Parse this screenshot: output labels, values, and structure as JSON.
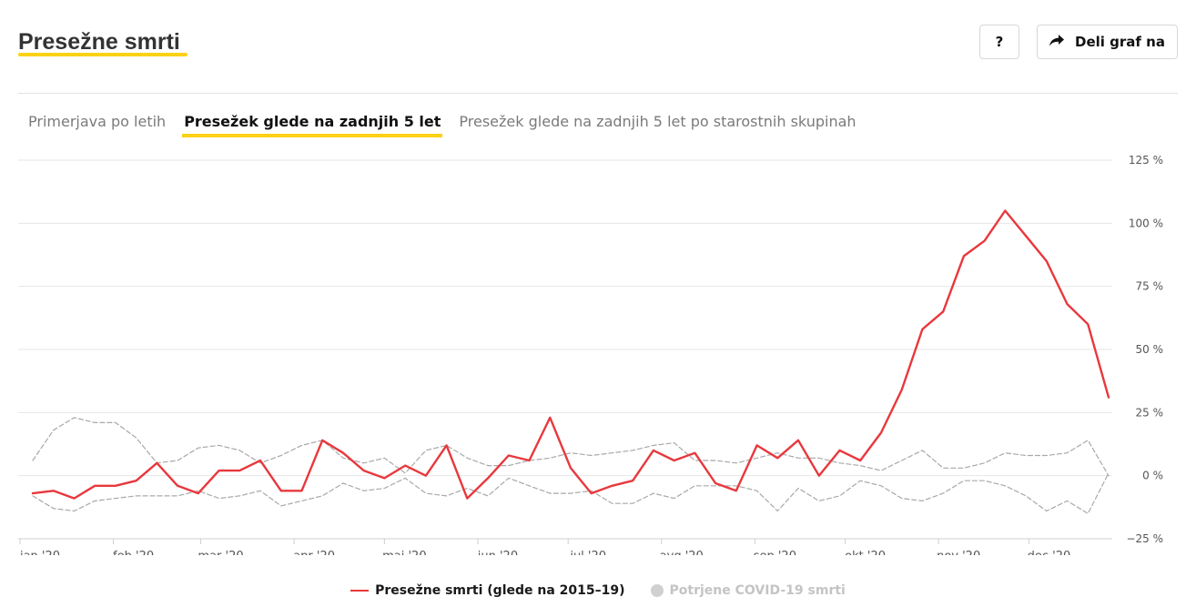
{
  "header": {
    "title": "Presežne smrti",
    "help_label": "?",
    "share_label": "Deli graf na",
    "share_icon": "share-arrow-icon",
    "accent_color": "#fcd116"
  },
  "tabs": [
    {
      "label": "Primerjava po letih",
      "active": false
    },
    {
      "label": "Presežek glede na zadnjih 5 let",
      "active": true
    },
    {
      "label": "Presežek glede na zadnjih 5 let po starostnih skupinah",
      "active": false
    }
  ],
  "chart_data": {
    "type": "line",
    "x": [
      "2020-01-01",
      "2020-01-08",
      "2020-01-15",
      "2020-01-22",
      "2020-01-29",
      "2020-02-05",
      "2020-02-12",
      "2020-02-19",
      "2020-02-26",
      "2020-03-04",
      "2020-03-11",
      "2020-03-18",
      "2020-03-25",
      "2020-04-01",
      "2020-04-08",
      "2020-04-15",
      "2020-04-22",
      "2020-04-29",
      "2020-05-06",
      "2020-05-13",
      "2020-05-20",
      "2020-05-27",
      "2020-06-03",
      "2020-06-10",
      "2020-06-17",
      "2020-06-24",
      "2020-07-01",
      "2020-07-08",
      "2020-07-15",
      "2020-07-22",
      "2020-07-29",
      "2020-08-05",
      "2020-08-12",
      "2020-08-19",
      "2020-08-26",
      "2020-09-02",
      "2020-09-09",
      "2020-09-16",
      "2020-09-23",
      "2020-09-30",
      "2020-10-07",
      "2020-10-14",
      "2020-10-21",
      "2020-10-28",
      "2020-11-04",
      "2020-11-11",
      "2020-11-18",
      "2020-11-25",
      "2020-12-02",
      "2020-12-09",
      "2020-12-16",
      "2020-12-23",
      "2020-12-30"
    ],
    "series": [
      {
        "name": "Presežne smrti (glede na 2015–19)",
        "color": "#e8383d",
        "values": [
          -7,
          -6,
          -9,
          -4,
          -4,
          -2,
          5,
          -4,
          -7,
          2,
          2,
          6,
          -6,
          -6,
          14,
          9,
          2,
          -1,
          4,
          0,
          12,
          -9,
          -1,
          8,
          6,
          23,
          3,
          -7,
          -4,
          -2,
          10,
          6,
          9,
          -3,
          -6,
          12,
          7,
          14,
          0,
          10,
          6,
          17,
          34,
          58,
          65,
          87,
          93,
          105,
          95,
          85,
          68,
          60,
          31
        ]
      },
      {
        "name": "",
        "color": "#a8a8a8",
        "dashed": true,
        "values": [
          6,
          18,
          23,
          21,
          21,
          15,
          5,
          6,
          11,
          12,
          10,
          5,
          8,
          12,
          14,
          7,
          5,
          7,
          1,
          10,
          12,
          7,
          4,
          4,
          6,
          7,
          9,
          8,
          9,
          10,
          12,
          13,
          6,
          6,
          5,
          7,
          9,
          7,
          7,
          5,
          4,
          2,
          6,
          10,
          3,
          3,
          5,
          9,
          8,
          8,
          9,
          14,
          0
        ]
      },
      {
        "name": "",
        "color": "#a8a8a8",
        "dashed": true,
        "values": [
          -8,
          -13,
          -14,
          -10,
          -9,
          -8,
          -8,
          -8,
          -6,
          -9,
          -8,
          -6,
          -12,
          -10,
          -8,
          -3,
          -6,
          -5,
          -1,
          -7,
          -8,
          -5,
          -8,
          -1,
          -4,
          -7,
          -7,
          -6,
          -11,
          -11,
          -7,
          -9,
          -4,
          -4,
          -4,
          -6,
          -14,
          -5,
          -10,
          -8,
          -2,
          -4,
          -9,
          -10,
          -7,
          -2,
          -2,
          -4,
          -8,
          -14,
          -10,
          -15,
          1
        ]
      }
    ],
    "xtick_labels": [
      "jan '20",
      "feb '20",
      "mar '20",
      "apr '20",
      "maj '20",
      "jun '20",
      "jul '20",
      "avg '20",
      "sep '20",
      "okt '20",
      "nov '20",
      "dec '20"
    ],
    "ytick_labels": [
      "125 %",
      "100 %",
      "75 %",
      "50 %",
      "25 %",
      "0 %",
      "−25 %"
    ],
    "ylim": [
      -25,
      125
    ],
    "grid": true,
    "legend_position": "bottom-center"
  },
  "legend": [
    {
      "label": "Presežne smrti (glede na 2015–19)",
      "color": "#e8383d",
      "marker": "line",
      "active": true
    },
    {
      "label": "Potrjene COVID-19 smrti",
      "color": "#c8c8c8",
      "marker": "dot",
      "active": false
    }
  ]
}
